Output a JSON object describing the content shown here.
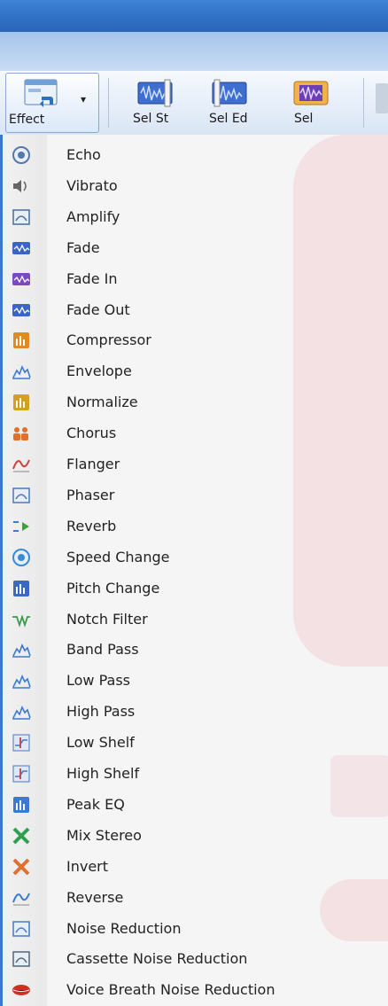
{
  "toolbar": {
    "effect_label": "Effect",
    "buttons": [
      {
        "label": "Sel St",
        "icon": "select-start-icon"
      },
      {
        "label": "Sel Ed",
        "icon": "select-end-icon"
      },
      {
        "label": "Sel",
        "icon": "select-icon"
      }
    ]
  },
  "menu": {
    "items": [
      {
        "label": "Echo",
        "icon": "echo-icon",
        "color": "#5577aa"
      },
      {
        "label": "Vibrato",
        "icon": "vibrato-icon",
        "color": "#666666"
      },
      {
        "label": "Amplify",
        "icon": "amplify-icon",
        "color": "#4a6d95"
      },
      {
        "label": "Fade",
        "icon": "fade-icon",
        "color": "#3b64c8"
      },
      {
        "label": "Fade In",
        "icon": "fade-in-icon",
        "color": "#7a4ac0"
      },
      {
        "label": "Fade Out",
        "icon": "fade-out-icon",
        "color": "#3b64c8"
      },
      {
        "label": "Compressor",
        "icon": "compressor-icon",
        "color": "#e08a20"
      },
      {
        "label": "Envelope",
        "icon": "envelope-icon",
        "color": "#3a7ad0"
      },
      {
        "label": "Normalize",
        "icon": "normalize-icon",
        "color": "#d4a020"
      },
      {
        "label": "Chorus",
        "icon": "chorus-icon",
        "color": "#e0702a"
      },
      {
        "label": "Flanger",
        "icon": "flanger-icon",
        "color": "#d04040"
      },
      {
        "label": "Phaser",
        "icon": "phaser-icon",
        "color": "#4a78c0"
      },
      {
        "label": "Reverb",
        "icon": "reverb-icon",
        "color": "#40a040"
      },
      {
        "label": "Speed Change",
        "icon": "speed-change-icon",
        "color": "#3a8ad8"
      },
      {
        "label": "Pitch Change",
        "icon": "pitch-change-icon",
        "color": "#3a6ac0"
      },
      {
        "label": "Notch Filter",
        "icon": "notch-filter-icon",
        "color": "#3a9a50"
      },
      {
        "label": "Band Pass",
        "icon": "band-pass-icon",
        "color": "#3a7ad0"
      },
      {
        "label": "Low Pass",
        "icon": "low-pass-icon",
        "color": "#3a7ad0"
      },
      {
        "label": "High Pass",
        "icon": "high-pass-icon",
        "color": "#3a7ad0"
      },
      {
        "label": "Low Shelf",
        "icon": "low-shelf-icon",
        "color": "#4a78c0"
      },
      {
        "label": "High Shelf",
        "icon": "high-shelf-icon",
        "color": "#4a78c0"
      },
      {
        "label": "Peak EQ",
        "icon": "peak-eq-icon",
        "color": "#3a7ad0"
      },
      {
        "label": "Mix Stereo",
        "icon": "mix-stereo-icon",
        "color": "#30a050"
      },
      {
        "label": "Invert",
        "icon": "invert-icon",
        "color": "#e07030"
      },
      {
        "label": "Reverse",
        "icon": "reverse-icon",
        "color": "#3a7ad0"
      },
      {
        "label": "Noise Reduction",
        "icon": "noise-reduction-icon",
        "color": "#4a78c0"
      },
      {
        "label": "Cassette Noise Reduction",
        "icon": "cassette-noise-reduction-icon",
        "color": "#556677"
      },
      {
        "label": "Voice Breath Noise Reduction",
        "icon": "voice-breath-noise-reduction-icon",
        "color": "#d03020"
      }
    ]
  }
}
